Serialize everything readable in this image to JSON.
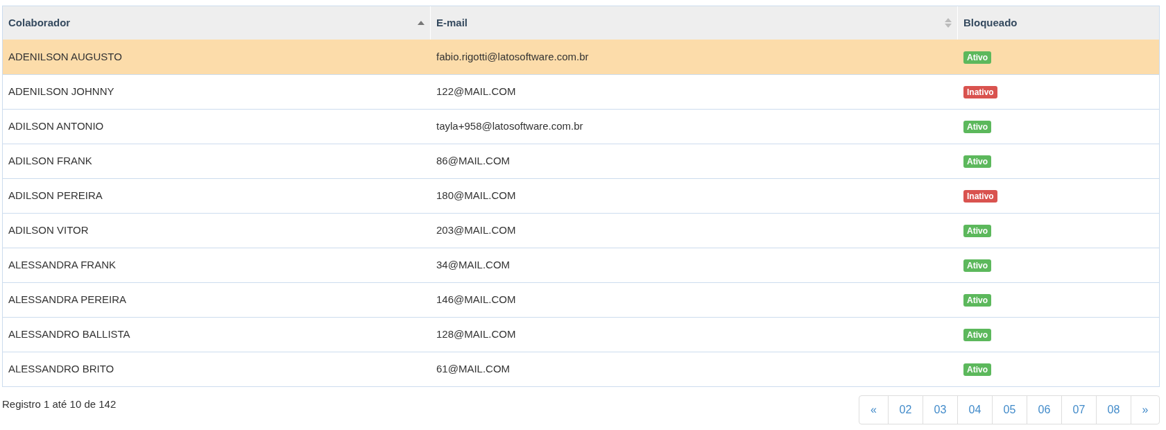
{
  "table": {
    "columns": [
      {
        "label": "Colaborador",
        "sortable": true,
        "sorted": true
      },
      {
        "label": "E-mail",
        "sortable": true,
        "sorted": false
      },
      {
        "label": "Bloqueado",
        "sortable": false,
        "sorted": false
      }
    ],
    "rows": [
      {
        "name": "ADENILSON AUGUSTO",
        "email": "fabio.rigotti@latosoftware.com.br",
        "status": {
          "label": "Ativo",
          "kind": "active"
        },
        "selected": true
      },
      {
        "name": "ADENILSON JOHNNY",
        "email": "122@MAIL.COM",
        "status": {
          "label": "Inativo",
          "kind": "inactive"
        },
        "selected": false
      },
      {
        "name": "ADILSON ANTONIO",
        "email": "tayla+958@latosoftware.com.br",
        "status": {
          "label": "Ativo",
          "kind": "active"
        },
        "selected": false
      },
      {
        "name": "ADILSON FRANK",
        "email": "86@MAIL.COM",
        "status": {
          "label": "Ativo",
          "kind": "active"
        },
        "selected": false
      },
      {
        "name": "ADILSON PEREIRA",
        "email": "180@MAIL.COM",
        "status": {
          "label": "Inativo",
          "kind": "inactive"
        },
        "selected": false
      },
      {
        "name": "ADILSON VITOR",
        "email": "203@MAIL.COM",
        "status": {
          "label": "Ativo",
          "kind": "active"
        },
        "selected": false
      },
      {
        "name": "ALESSANDRA FRANK",
        "email": "34@MAIL.COM",
        "status": {
          "label": "Ativo",
          "kind": "active"
        },
        "selected": false
      },
      {
        "name": "ALESSANDRA PEREIRA",
        "email": "146@MAIL.COM",
        "status": {
          "label": "Ativo",
          "kind": "active"
        },
        "selected": false
      },
      {
        "name": "ALESSANDRO BALLISTA",
        "email": "128@MAIL.COM",
        "status": {
          "label": "Ativo",
          "kind": "active"
        },
        "selected": false
      },
      {
        "name": "ALESSANDRO BRITO",
        "email": "61@MAIL.COM",
        "status": {
          "label": "Ativo",
          "kind": "active"
        },
        "selected": false
      }
    ]
  },
  "footer": {
    "info": "Registro 1 até 10 de 142"
  },
  "pagination": [
    "«",
    "02",
    "03",
    "04",
    "05",
    "06",
    "07",
    "08",
    "»"
  ]
}
